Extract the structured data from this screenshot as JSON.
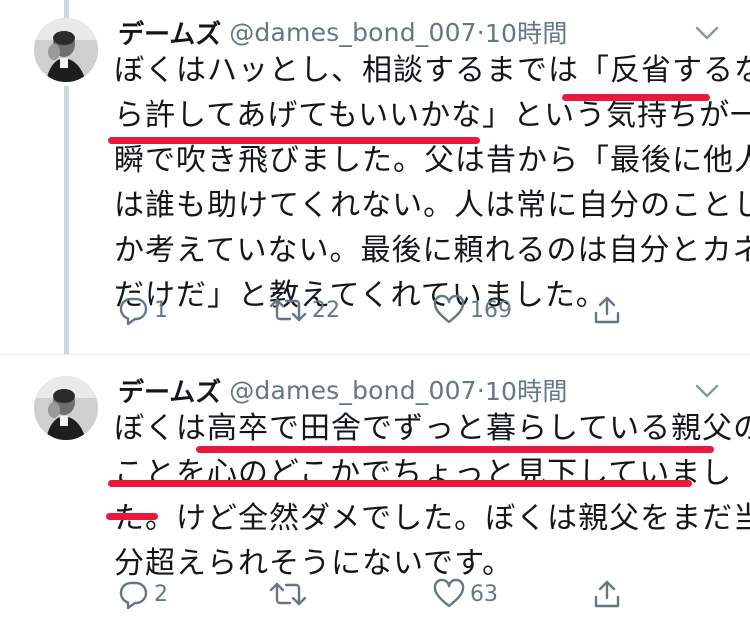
{
  "tweets": [
    {
      "author_name": "デームズ",
      "handle": "@dames_bond_007",
      "separator": "·",
      "time": "10時間",
      "lines": [
        "ぼくはハッとし、相談するまでは「反省するな",
        "ら許してあげてもいいかな」という気持ちが一",
        "瞬で吹き飛びました。父は昔から「最後に他人",
        "は誰も助けてくれない。人は常に自分のことし",
        "か考えていない。最後に頼れるのは自分とカネ",
        "だけだ」と教えてくれていました。"
      ],
      "counts": {
        "reply": "1",
        "retweet": "22",
        "like": "169"
      }
    },
    {
      "author_name": "デームズ",
      "handle": "@dames_bond_007",
      "separator": "·",
      "time": "10時間",
      "lines": [
        "ぼくは高卒で田舎でずっと暮らしている親父の",
        "ことを心のどこかでちょっと見下していまし",
        "た。けど全然ダメでした。ぼくは親父をまだ当",
        "分超えられそうにないです。"
      ],
      "counts": {
        "reply": "2",
        "retweet": "",
        "like": "63"
      }
    }
  ],
  "icons": {
    "reply": "reply-icon",
    "retweet": "retweet-icon",
    "like": "heart-icon",
    "share": "share-icon",
    "caret": "chevron-down-icon"
  },
  "colors": {
    "text": "#14171a",
    "secondary": "#657786",
    "thread_line": "#ccd6dd",
    "highlight_underline": "#e8193c"
  }
}
